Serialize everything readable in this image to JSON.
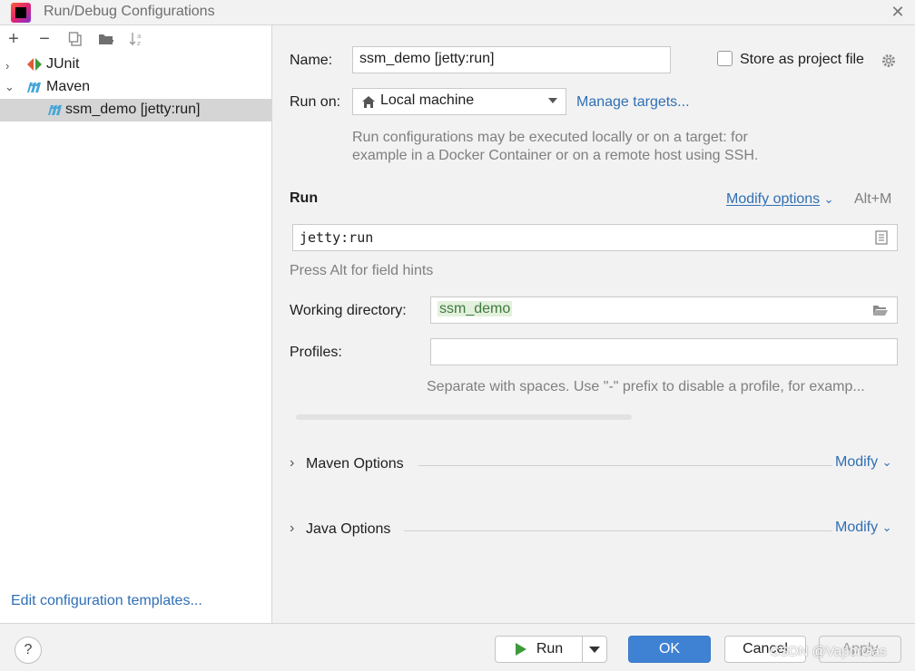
{
  "window": {
    "title": "Run/Debug Configurations"
  },
  "toolbar": {
    "add": "+",
    "remove": "−"
  },
  "tree": {
    "junit": "JUnit",
    "maven": "Maven",
    "config": "ssm_demo [jetty:run]"
  },
  "left_footer": {
    "edit_templates": "Edit configuration templates..."
  },
  "form": {
    "name_label": "Name:",
    "name_value": "ssm_demo [jetty:run]",
    "store_label": "Store as project file",
    "run_on_label": "Run on:",
    "run_on_value": "Local machine",
    "manage_targets": "Manage targets...",
    "run_on_hint_1": "Run configurations may be executed locally or on a target: for",
    "run_on_hint_2": "example in a Docker Container or on a remote host using SSH.",
    "run_section": "Run",
    "modify_options": "Modify options",
    "modify_shortcut": "Alt+M",
    "command_value": "jetty:run",
    "field_hint": "Press Alt for field hints",
    "working_dir_label": "Working directory:",
    "working_dir_value": "ssm_demo",
    "profiles_label": "Profiles:",
    "profiles_value": "",
    "profiles_hint": "Separate with spaces. Use \"-\" prefix to disable a profile, for examp..."
  },
  "sections": {
    "maven_options": "Maven Options",
    "java_options": "Java Options",
    "modify": "Modify"
  },
  "buttons": {
    "help": "?",
    "run": "Run",
    "ok": "OK",
    "cancel": "Cancel",
    "apply": "Apply"
  },
  "watermark": "CSDN @VaporGas",
  "colors": {
    "accent": "#3f82d3",
    "link": "#2f6fb5",
    "run_green": "#3c9a3c",
    "maven_blue": "#45a6d9"
  }
}
